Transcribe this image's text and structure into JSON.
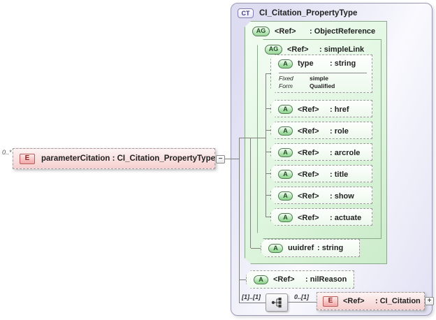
{
  "diagram": {
    "root_element": {
      "cardinality": "0..*",
      "badge": "E",
      "label": "parameterCitation : CI_Citation_PropertyType"
    },
    "complex_type": {
      "badge": "CT",
      "title": "CI_Citation_PropertyType"
    },
    "object_reference": {
      "badge": "AG",
      "name": "<Ref>",
      "type": ": ObjectReference"
    },
    "simple_link": {
      "badge": "AG",
      "name": "<Ref>",
      "type": ": simpleLink"
    },
    "type_attr": {
      "badge": "A",
      "name": "type",
      "type": ": string",
      "facets": [
        {
          "label": "Fixed",
          "value": "simple"
        },
        {
          "label": "Form",
          "value": "Qualified"
        }
      ]
    },
    "attrs": [
      {
        "badge": "A",
        "name": "<Ref>",
        "type": ": href"
      },
      {
        "badge": "A",
        "name": "<Ref>",
        "type": ": role"
      },
      {
        "badge": "A",
        "name": "<Ref>",
        "type": ": arcrole"
      },
      {
        "badge": "A",
        "name": "<Ref>",
        "type": ": title"
      },
      {
        "badge": "A",
        "name": "<Ref>",
        "type": ": show"
      },
      {
        "badge": "A",
        "name": "<Ref>",
        "type": ": actuate"
      }
    ],
    "uuidref_attr": {
      "badge": "A",
      "name": "uuidref",
      "type": ": string"
    },
    "nil_reason_attr": {
      "badge": "A",
      "name": "<Ref>",
      "type": ": nilReason"
    },
    "sequence": {
      "left_cardinality": "[1]..[1]",
      "right_cardinality": "0..[1]"
    },
    "citation_element": {
      "badge": "E",
      "name": "<Ref>",
      "type": ": CI_Citation"
    },
    "icons": {
      "collapse": "−",
      "expand": "+"
    }
  },
  "colors": {
    "element_pink": "#f6cfcf",
    "attribute_group_green": "#ddf5dd",
    "complex_type_lavender": "#dedcf2",
    "badge_red_text": "#8b2222",
    "badge_green_text": "#1f4f1f",
    "badge_blue_text": "#3b3b7a",
    "connector_gray": "#808080"
  }
}
